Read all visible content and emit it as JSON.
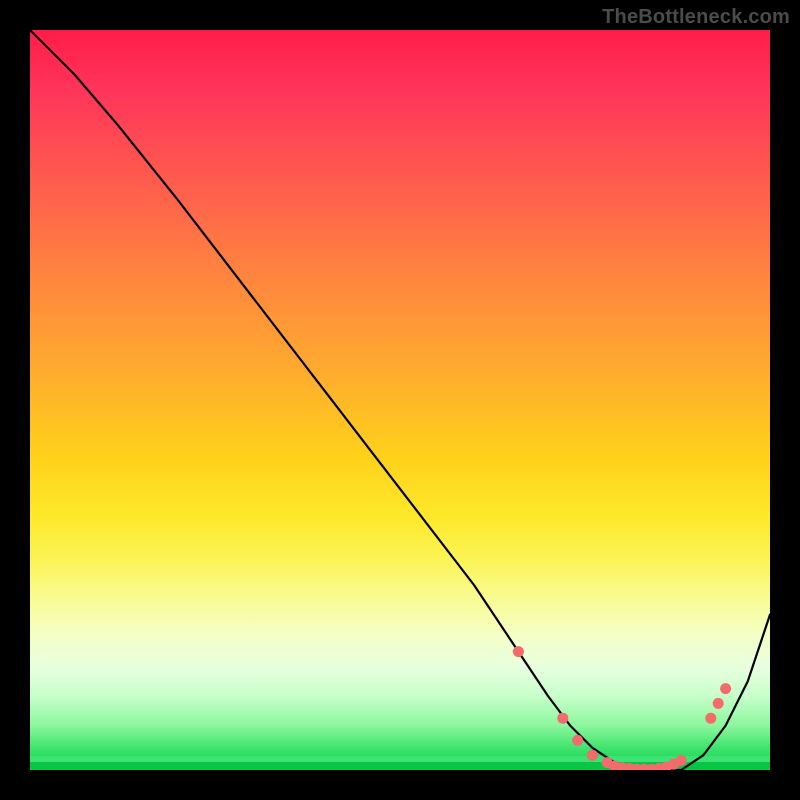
{
  "watermark": "TheBottleneck.com",
  "colors": {
    "background": "#000000",
    "watermark": "#4b4b4b",
    "curve": "#000000",
    "marker": "#f46b6b"
  },
  "chart_data": {
    "type": "line",
    "title": "",
    "xlabel": "",
    "ylabel": "",
    "xlim": [
      0,
      100
    ],
    "ylim": [
      0,
      100
    ],
    "gradient_stops": [
      {
        "pos": 0,
        "color": "#ff1d49"
      },
      {
        "pos": 8,
        "color": "#ff345b"
      },
      {
        "pos": 20,
        "color": "#ff5a4e"
      },
      {
        "pos": 33,
        "color": "#ff843f"
      },
      {
        "pos": 46,
        "color": "#ffab2e"
      },
      {
        "pos": 58,
        "color": "#ffd21a"
      },
      {
        "pos": 66,
        "color": "#fde92b"
      },
      {
        "pos": 72,
        "color": "#fbf55a"
      },
      {
        "pos": 77,
        "color": "#f9fb94"
      },
      {
        "pos": 82,
        "color": "#f4ffc8"
      },
      {
        "pos": 86,
        "color": "#e8ffde"
      },
      {
        "pos": 90,
        "color": "#c7ffcb"
      },
      {
        "pos": 94,
        "color": "#8cf79d"
      },
      {
        "pos": 97,
        "color": "#3fe46e"
      },
      {
        "pos": 100,
        "color": "#09cf4b"
      }
    ],
    "series": [
      {
        "name": "bottleneck-curve",
        "x": [
          0,
          6,
          12,
          20,
          30,
          40,
          50,
          60,
          66,
          70,
          73,
          76,
          79,
          82,
          85,
          88,
          91,
          94,
          97,
          100
        ],
        "y": [
          100,
          94,
          87,
          77,
          64,
          51,
          38,
          25,
          16,
          10,
          6,
          3,
          1,
          0,
          0,
          0,
          2,
          6,
          12,
          21
        ]
      }
    ],
    "markers": {
      "name": "highlighted-points",
      "points": [
        {
          "x": 66,
          "y": 16
        },
        {
          "x": 72,
          "y": 7
        },
        {
          "x": 74,
          "y": 4
        },
        {
          "x": 76,
          "y": 2
        },
        {
          "x": 78,
          "y": 1
        },
        {
          "x": 79,
          "y": 0.5
        },
        {
          "x": 80,
          "y": 0.3
        },
        {
          "x": 81,
          "y": 0.2
        },
        {
          "x": 82,
          "y": 0.1
        },
        {
          "x": 83,
          "y": 0.1
        },
        {
          "x": 84,
          "y": 0.1
        },
        {
          "x": 85,
          "y": 0.2
        },
        {
          "x": 86,
          "y": 0.4
        },
        {
          "x": 87,
          "y": 0.8
        },
        {
          "x": 88,
          "y": 1.3
        },
        {
          "x": 92,
          "y": 7
        },
        {
          "x": 93,
          "y": 9
        },
        {
          "x": 94,
          "y": 11
        }
      ]
    }
  }
}
